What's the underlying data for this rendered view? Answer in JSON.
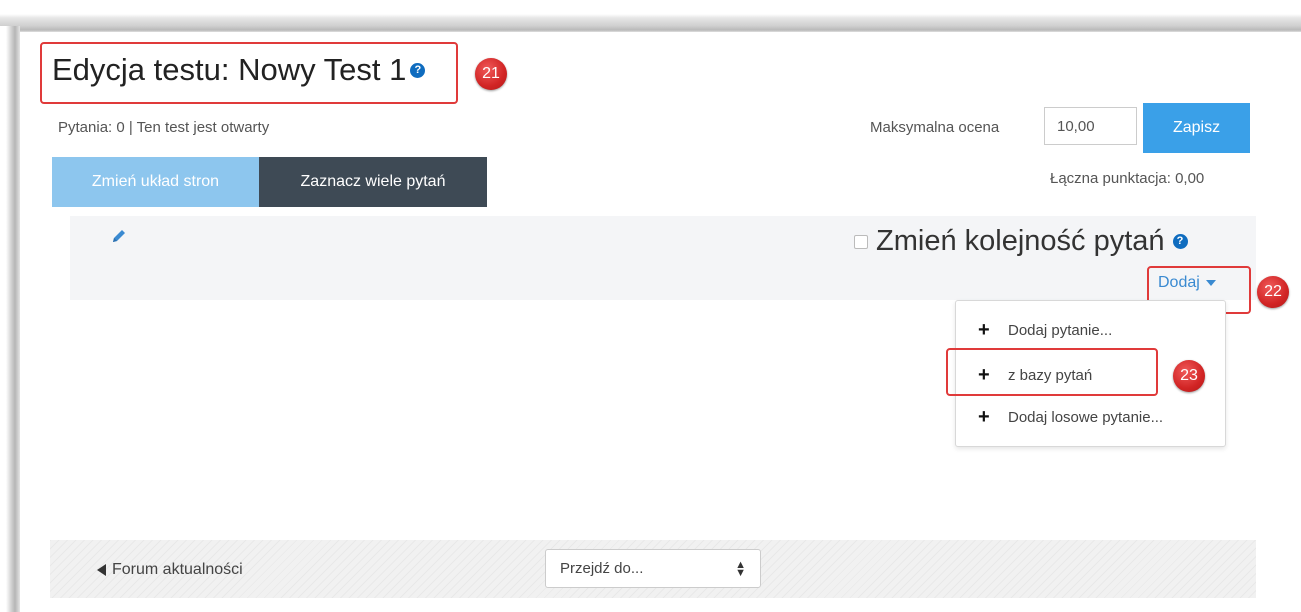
{
  "page": {
    "title": "Edycja testu: Nowy Test 1",
    "help_glyph": "?"
  },
  "quiz_info": "Pytania: 0 | Ten test jest otwarty",
  "grading": {
    "max_grade_label": "Maksymalna ocena",
    "max_grade_value": "10,00",
    "save_label": "Zapisz",
    "total_marks": "Łączna punktacja: 0,00"
  },
  "toolbar": {
    "repaginate_label": "Zmień układ stron",
    "select_multiple_label": "Zaznacz wiele pytań"
  },
  "section": {
    "shuffle_label": "Zmień kolejność pytań",
    "add_label": "Dodaj"
  },
  "add_menu": {
    "items": [
      {
        "label": "Dodaj pytanie...",
        "icon": "plus-icon"
      },
      {
        "label": "z bazy pytań",
        "icon": "plus-icon"
      },
      {
        "label": "Dodaj losowe pytanie...",
        "icon": "plus-icon"
      }
    ]
  },
  "footer": {
    "prev_activity": "Forum aktualności",
    "jump_placeholder": "Przejdź do..."
  },
  "callouts": [
    "21",
    "22",
    "23"
  ],
  "colors": {
    "primary": "#3aa0e8",
    "dark_button": "#3e4a55",
    "callout_red": "#d92b2b",
    "link": "#3a8ad1"
  }
}
